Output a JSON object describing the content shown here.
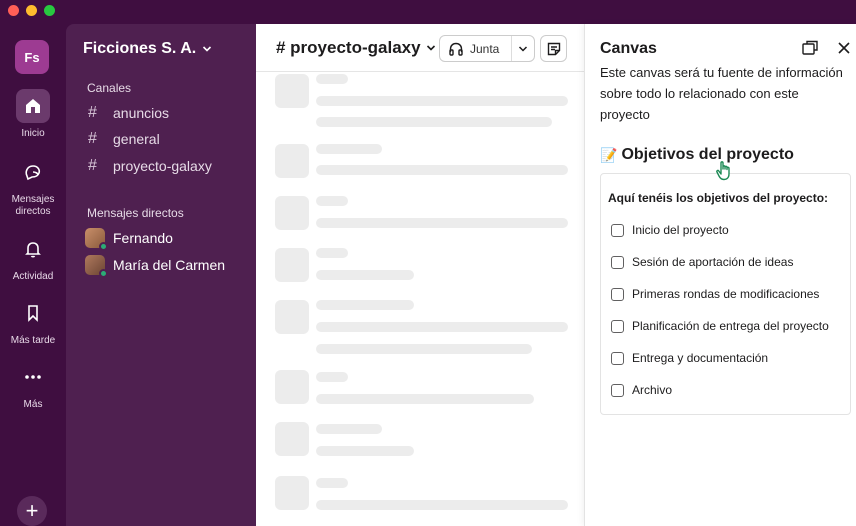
{
  "workspace": {
    "initials": "Fs",
    "name": "Ficciones S. A."
  },
  "rail": {
    "items": [
      {
        "label": "Inicio"
      },
      {
        "label": "Mensajes directos"
      },
      {
        "label": "Actividad"
      },
      {
        "label": "Más tarde"
      },
      {
        "label": "Más"
      }
    ],
    "add_label": "+"
  },
  "sidebar": {
    "channels_title": "Canales",
    "channels": [
      {
        "name": "anuncios"
      },
      {
        "name": "general"
      },
      {
        "name": "proyecto-galaxy"
      }
    ],
    "dms_title": "Mensajes directos",
    "dms": [
      {
        "name": "Fernando"
      },
      {
        "name": "María del Carmen"
      }
    ]
  },
  "channel": {
    "name": "# proyecto-galaxy",
    "huddle_label": "Junta"
  },
  "canvas": {
    "title": "Canvas",
    "intro": "Este canvas será tu fuente de información sobre todo lo relacionado con este proyecto",
    "objectives_title": "Objetivos del proyecto",
    "objectives_intro": "Aquí tenéis los objetivos del proyecto:",
    "objectives": [
      {
        "label": "Inicio del proyecto",
        "checked": false
      },
      {
        "label": "Sesión de aportación de ideas",
        "checked": false
      },
      {
        "label": "Primeras rondas de modificaciones",
        "checked": false
      },
      {
        "label": "Planificación de entrega del proyecto",
        "checked": false
      },
      {
        "label": "Entrega y documentación",
        "checked": false
      },
      {
        "label": "Archivo",
        "checked": false
      }
    ]
  },
  "colors": {
    "aubergine": "#3f0e40",
    "sidebar": "#4f2050",
    "workspace_icon": "#9d3b92",
    "presence": "#2bac76"
  }
}
